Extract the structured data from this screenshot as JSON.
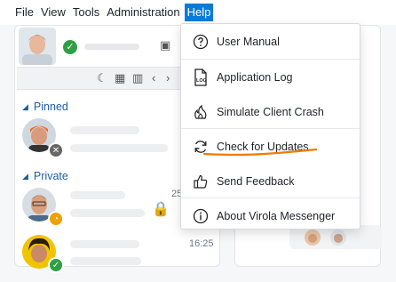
{
  "menubar": {
    "items": [
      "File",
      "View",
      "Tools",
      "Administration",
      "Help"
    ],
    "active": "Help"
  },
  "sections": {
    "pinned": "Pinned",
    "private": "Private"
  },
  "contacts": [
    {
      "time": "",
      "status": "offline"
    },
    {
      "time": "25",
      "status": "away"
    },
    {
      "time": "16:25",
      "status": "online"
    }
  ],
  "help_menu": {
    "items": [
      {
        "label": "User Manual",
        "icon": "help-circle-icon"
      },
      {
        "label": "Application Log",
        "icon": "log-file-icon"
      },
      {
        "label": "Simulate Client Crash",
        "icon": "crash-flame-icon"
      },
      {
        "label": "Check for Updates",
        "icon": "refresh-icon"
      },
      {
        "label": "Send Feedback",
        "icon": "thumbs-up-icon"
      },
      {
        "label": "About Virola Messenger",
        "icon": "info-icon"
      }
    ]
  },
  "colors": {
    "menu_active": "#0b7bd6",
    "section_title": "#1d5fa5",
    "status_online": "#2ea043",
    "status_away": "#f0a000",
    "underline": "#f07a00"
  }
}
